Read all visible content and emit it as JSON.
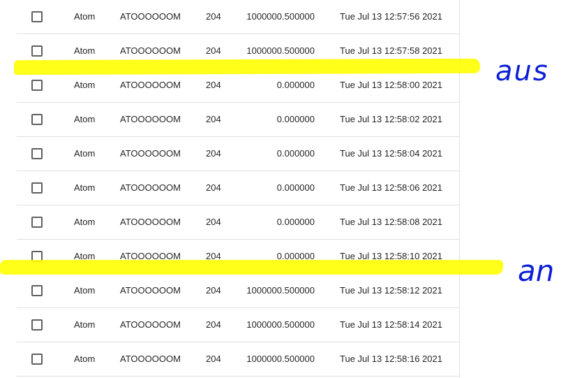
{
  "table": {
    "rows": [
      {
        "name": "Atom",
        "symbol": "ATOOOOOOM",
        "code": "204",
        "value": "1000000.500000",
        "time": "Tue Jul 13 12:57:56 2021"
      },
      {
        "name": "Atom",
        "symbol": "ATOOOOOOM",
        "code": "204",
        "value": "1000000.500000",
        "time": "Tue Jul 13 12:57:58 2021"
      },
      {
        "name": "Atom",
        "symbol": "ATOOOOOOM",
        "code": "204",
        "value": "0.000000",
        "time": "Tue Jul 13 12:58:00 2021"
      },
      {
        "name": "Atom",
        "symbol": "ATOOOOOOM",
        "code": "204",
        "value": "0.000000",
        "time": "Tue Jul 13 12:58:02 2021"
      },
      {
        "name": "Atom",
        "symbol": "ATOOOOOOM",
        "code": "204",
        "value": "0.000000",
        "time": "Tue Jul 13 12:58:04 2021"
      },
      {
        "name": "Atom",
        "symbol": "ATOOOOOOM",
        "code": "204",
        "value": "0.000000",
        "time": "Tue Jul 13 12:58:06 2021"
      },
      {
        "name": "Atom",
        "symbol": "ATOOOOOOM",
        "code": "204",
        "value": "0.000000",
        "time": "Tue Jul 13 12:58:08 2021"
      },
      {
        "name": "Atom",
        "symbol": "ATOOOOOOM",
        "code": "204",
        "value": "0.000000",
        "time": "Tue Jul 13 12:58:10 2021"
      },
      {
        "name": "Atom",
        "symbol": "ATOOOOOOM",
        "code": "204",
        "value": "1000000.500000",
        "time": "Tue Jul 13 12:58:12 2021"
      },
      {
        "name": "Atom",
        "symbol": "ATOOOOOOM",
        "code": "204",
        "value": "1000000.500000",
        "time": "Tue Jul 13 12:58:14 2021"
      },
      {
        "name": "Atom",
        "symbol": "ATOOOOOOM",
        "code": "204",
        "value": "1000000.500000",
        "time": "Tue Jul 13 12:58:16 2021"
      }
    ]
  },
  "annotations": {
    "aus": "aus",
    "an": "an",
    "ink_color": "#0a1fd6",
    "highlight_color": "#ffff00"
  }
}
